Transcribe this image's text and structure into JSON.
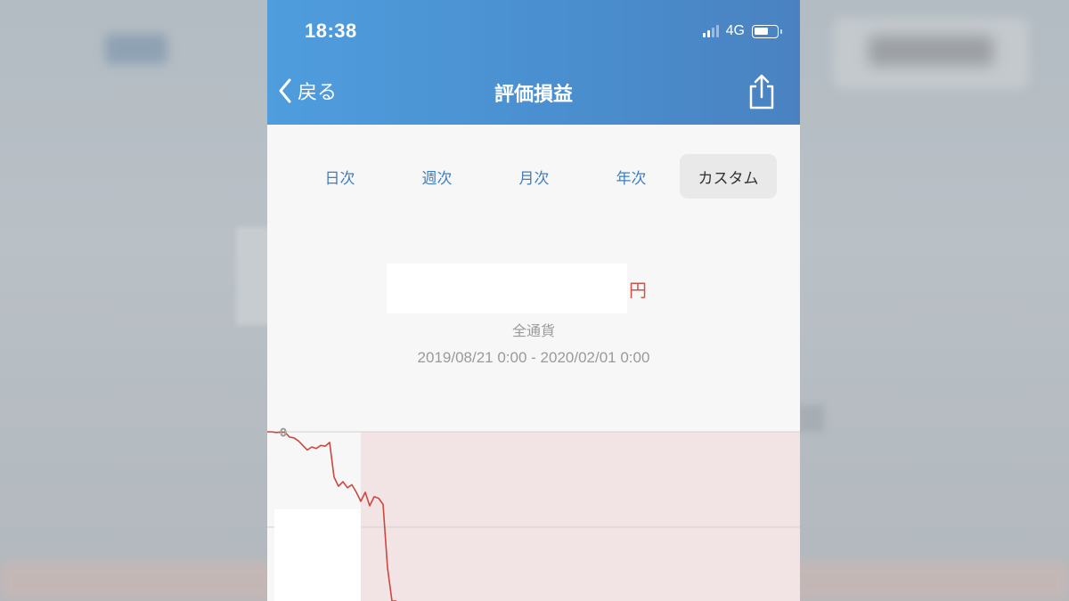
{
  "status_bar": {
    "time": "18:38",
    "network": "4G"
  },
  "nav": {
    "back_label": "戻る",
    "title": "評価損益"
  },
  "tabs": [
    {
      "label": "日次",
      "active": false
    },
    {
      "label": "週次",
      "active": false
    },
    {
      "label": "月次",
      "active": false
    },
    {
      "label": "年次",
      "active": false
    },
    {
      "label": "カスタム",
      "active": true
    }
  ],
  "summary": {
    "amount_unit": "円",
    "currency": "全通貨",
    "period": "2019/08/21 0:00 - 2020/02/01 0:00"
  },
  "chart_data": {
    "type": "line",
    "zero_label": "0",
    "series": [
      {
        "values": [
          0,
          0,
          -0.5,
          -0.2,
          -0.3,
          -3.5,
          -4,
          -6,
          -9,
          -12,
          -10,
          -11,
          -9,
          -9.5,
          -7,
          -30,
          -36,
          -33,
          -37,
          -35,
          -40,
          -46,
          -40,
          -49,
          -43,
          -44,
          -48,
          -90,
          -112
        ]
      }
    ],
    "colors": {
      "line": "#c9493f",
      "fill": "#f2e4e4",
      "grid": "#d6cfcf"
    }
  },
  "colors": {
    "header_start": "#4f9ddd",
    "header_end": "#4a82c1",
    "tab_text": "#3f7fbe",
    "loss_red": "#d0534a"
  }
}
